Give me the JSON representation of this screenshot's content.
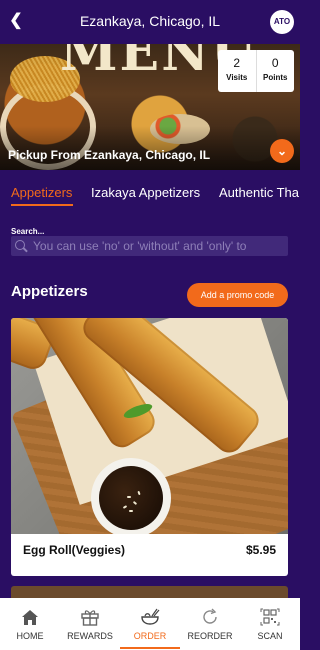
{
  "header": {
    "title": "Ezankaya, Chicago, IL",
    "avatar": "ATO"
  },
  "hero": {
    "banner_text": "MENU",
    "pickup_text": "Pickup From Ezankaya, Chicago, IL",
    "stats": [
      {
        "value": "2",
        "label": "Visits"
      },
      {
        "value": "0",
        "label": "Points"
      }
    ]
  },
  "tabs": [
    {
      "label": "Appetizers",
      "active": true
    },
    {
      "label": "Izakaya Appetizers",
      "active": false
    },
    {
      "label": "Authentic Tha",
      "active": false
    }
  ],
  "search": {
    "label": "Search...",
    "placeholder": "You can use 'no' or 'without' and 'only' to"
  },
  "section": {
    "title": "Appetizers",
    "promo_label": "Add a promo code"
  },
  "items": [
    {
      "name": "Egg Roll(Veggies)",
      "price": "$5.95"
    }
  ],
  "bottom_nav": [
    {
      "label": "HOME",
      "icon": "home-icon"
    },
    {
      "label": "REWARDS",
      "icon": "gift-icon"
    },
    {
      "label": "ORDER",
      "icon": "order-bowl-icon",
      "active": true
    },
    {
      "label": "REORDER",
      "icon": "reorder-icon"
    },
    {
      "label": "SCAN",
      "icon": "qr-scan-icon"
    }
  ],
  "colors": {
    "background": "#2a0e63",
    "accent": "#f26a1b"
  }
}
